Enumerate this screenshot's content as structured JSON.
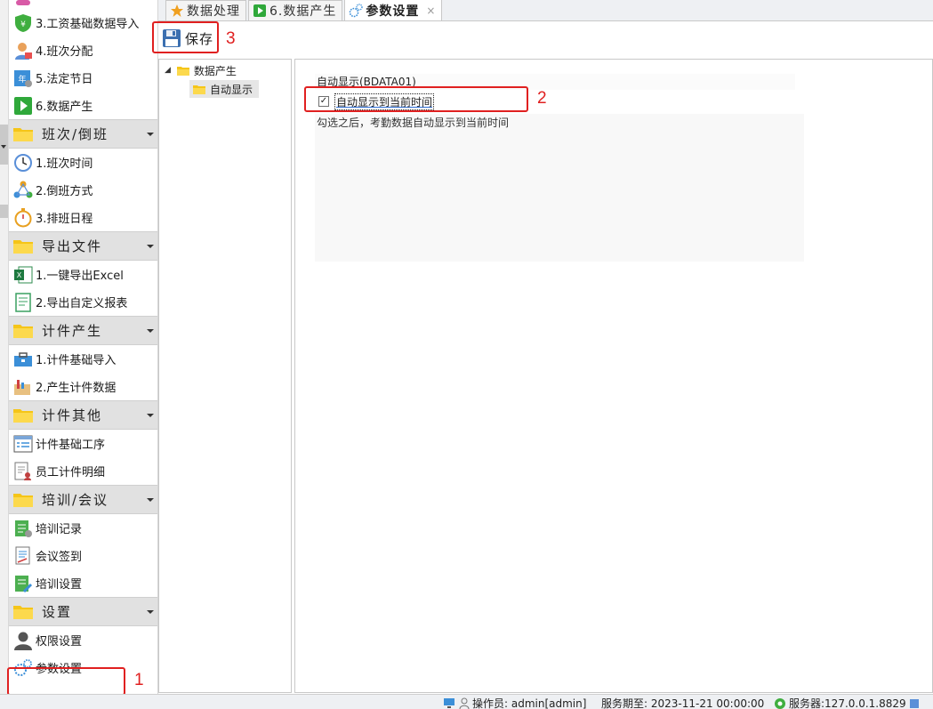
{
  "tabs": [
    {
      "label": "数据处理",
      "icon": "star-icon"
    },
    {
      "label": "6.数据产生",
      "icon": "play-icon"
    },
    {
      "label": "参数设置",
      "icon": "gears-icon",
      "close": "×"
    }
  ],
  "toolbar": {
    "save_label": "保存"
  },
  "sidebar": {
    "items": [
      {
        "label": "3.工资基础数据导入",
        "icon": "shield-money-icon"
      },
      {
        "label": "4.班次分配",
        "icon": "user-assign-icon"
      },
      {
        "label": "5.法定节日",
        "icon": "calendar-year-icon",
        "icon_text": "年"
      },
      {
        "label": "6.数据产生",
        "icon": "play-icon"
      }
    ],
    "groups": [
      {
        "label": "班次/倒班",
        "items": [
          {
            "label": "1.班次时间",
            "icon": "clock-icon"
          },
          {
            "label": "2.倒班方式",
            "icon": "share-nodes-icon"
          },
          {
            "label": "3.排班日程",
            "icon": "stopwatch-icon"
          }
        ]
      },
      {
        "label": "导出文件",
        "items": [
          {
            "label": "1.一键导出Excel",
            "icon": "excel-icon"
          },
          {
            "label": "2.导出自定义报表",
            "icon": "report-icon"
          }
        ]
      },
      {
        "label": "计件产生",
        "items": [
          {
            "label": "1.计件基础导入",
            "icon": "toolbox-icon"
          },
          {
            "label": "2.产生计件数据",
            "icon": "box-chart-icon"
          }
        ]
      },
      {
        "label": "计件其他",
        "items": [
          {
            "label": "计件基础工序",
            "icon": "list-window-icon"
          },
          {
            "label": "员工计件明细",
            "icon": "doc-person-icon"
          }
        ]
      },
      {
        "label": "培训/会议",
        "items": [
          {
            "label": "培训记录",
            "icon": "training-record-icon"
          },
          {
            "label": "会议签到",
            "icon": "sign-in-icon"
          },
          {
            "label": "培训设置",
            "icon": "training-setting-icon"
          }
        ]
      },
      {
        "label": "设置",
        "items": [
          {
            "label": "权限设置",
            "icon": "user-silhouette-icon"
          },
          {
            "label": "参数设置",
            "icon": "gears-icon"
          }
        ]
      }
    ]
  },
  "tree": {
    "root": "数据产生",
    "child": "自动显示"
  },
  "param": {
    "title": "自动显示(BDATA01)",
    "checkbox_label": "自动显示到当前时间",
    "checked": true,
    "check_mark": "✓",
    "description": "勾选之后，考勤数据自动显示到当前时间"
  },
  "annotations": [
    "1",
    "2",
    "3"
  ],
  "status": {
    "operator": "操作员: admin[admin]",
    "service_period": "服务期至: 2023-11-21 00:00:00",
    "server": "服务器:127.0.0.1.8829"
  },
  "colors": {
    "accent_red": "#e02020",
    "folder_yellow": "#f5c518",
    "group_bg": "#e1e1e1"
  }
}
